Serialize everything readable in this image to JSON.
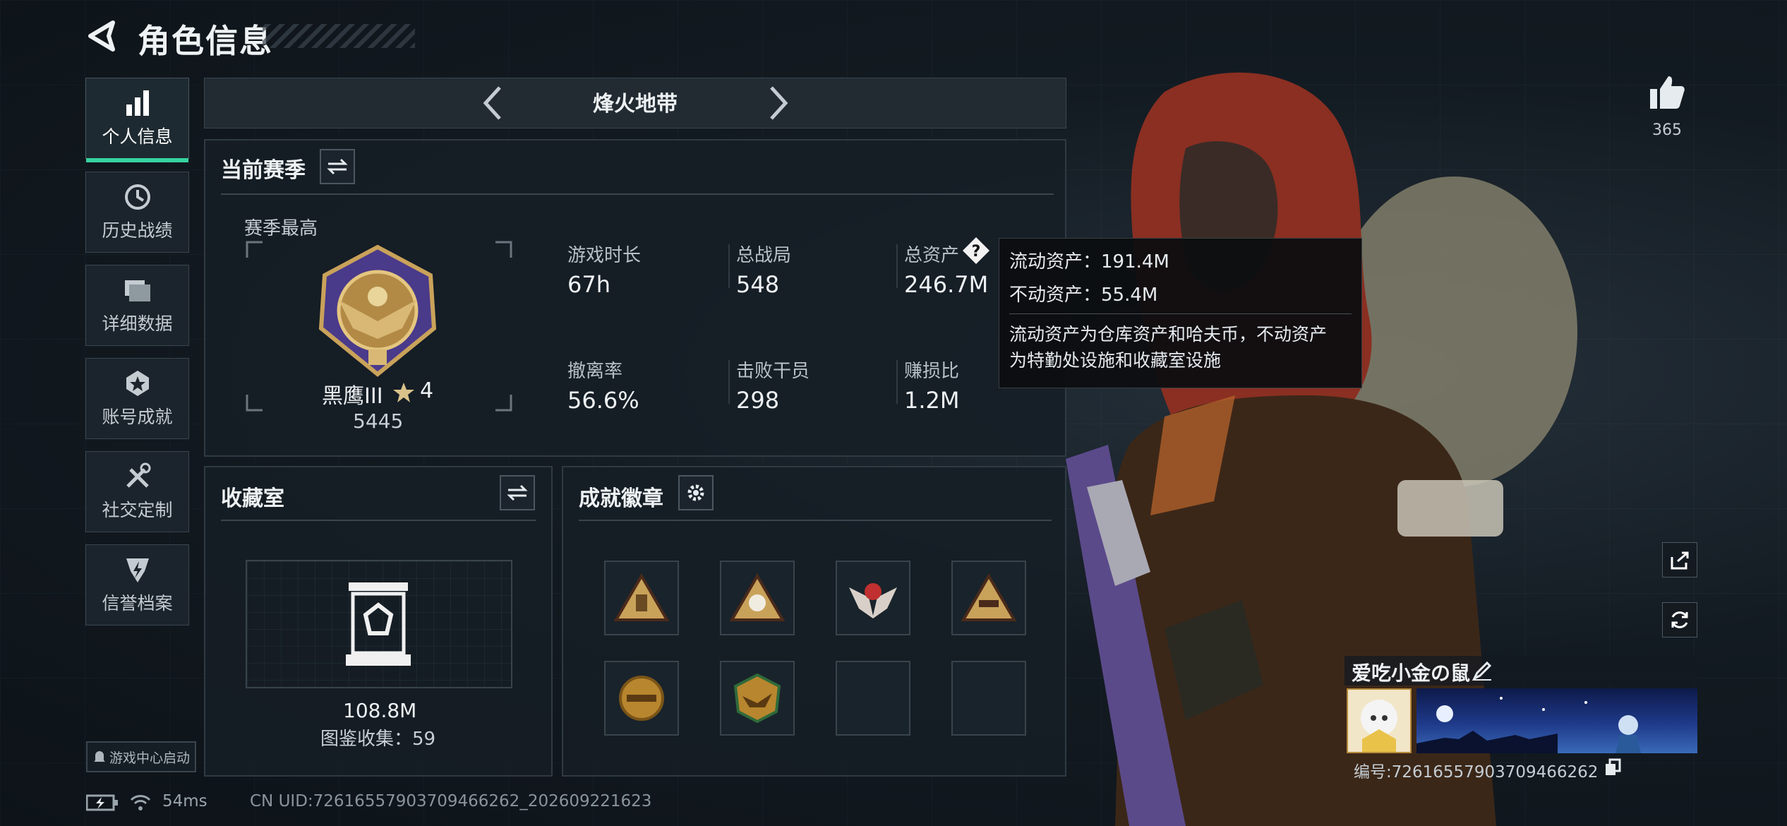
{
  "header": {
    "title": "角色信息"
  },
  "sidebar": {
    "items": [
      {
        "label": "个人信息",
        "icon": "bar-chart-icon"
      },
      {
        "label": "历史战绩",
        "icon": "clock-icon"
      },
      {
        "label": "详细数据",
        "icon": "folders-icon"
      },
      {
        "label": "账号成就",
        "icon": "achievement-star-icon"
      },
      {
        "label": "社交定制",
        "icon": "tools-icon"
      },
      {
        "label": "信誉档案",
        "icon": "shield-badge-icon"
      }
    ]
  },
  "game_center": "游戏中心启动",
  "mode": {
    "title": "烽火地带"
  },
  "season": {
    "title": "当前赛季",
    "best_label": "赛季最高",
    "rank_name": "黑鹰III",
    "rank_stars": "4",
    "rank_score": "5445",
    "stats": [
      {
        "label": "游戏时长",
        "value": "67h"
      },
      {
        "label": "总战局",
        "value": "548"
      },
      {
        "label": "总资产",
        "value": "246.7M"
      },
      {
        "label": "撤离率",
        "value": "56.6%"
      },
      {
        "label": "击败干员",
        "value": "298"
      },
      {
        "label": "赚损比",
        "value": "1.2M"
      }
    ]
  },
  "tooltip": {
    "liquid": "流动资产：191.4M",
    "fixed": "不动资产：55.4M",
    "desc_line1": "流动资产为仓库资产和哈夫币，不动资产",
    "desc_line2": "为特勤处设施和收藏室设施"
  },
  "collection": {
    "title": "收藏室",
    "value": "108.8M",
    "catalog": "图鉴收集：59"
  },
  "badges": {
    "title": "成就徽章"
  },
  "likes": {
    "count": "365"
  },
  "player": {
    "name": "爱吃小金の鼠",
    "id": "编号:7261655790370946626​2"
  },
  "status": {
    "ping": "54ms",
    "uid": "CN UID:7261655790370946626​2_202609221623"
  },
  "colors": {
    "accent": "#36d3a0",
    "panel": "#161e25",
    "gold": "#c9a25a"
  }
}
